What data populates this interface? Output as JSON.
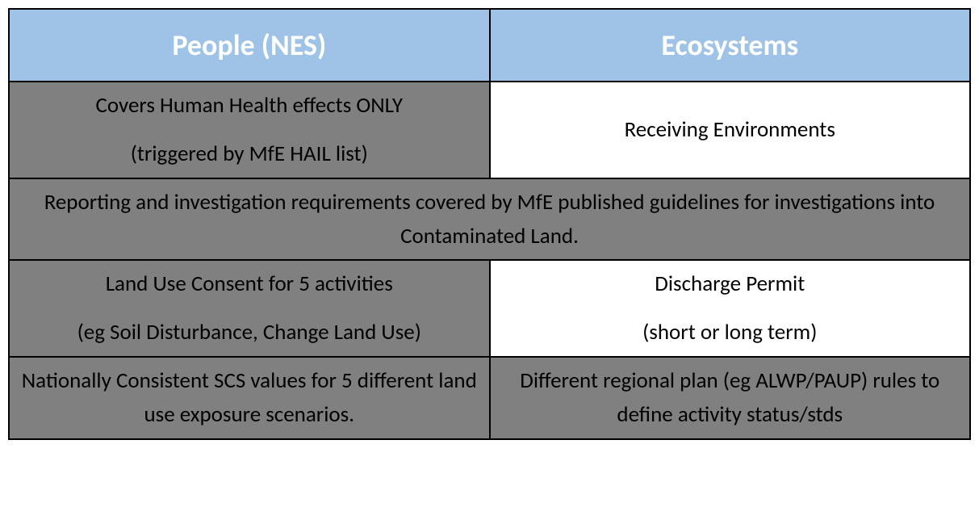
{
  "headers": {
    "col1": "People (NES)",
    "col2": "Ecosystems"
  },
  "row1": {
    "left_line1": "Covers Human Health effects ONLY",
    "left_line2": "(triggered by MfE HAIL list)",
    "right": "Receiving Environments"
  },
  "row2": {
    "merged": "Reporting and investigation requirements covered by MfE published guidelines for investigations into Contaminated Land."
  },
  "row3": {
    "left_line1": "Land Use Consent for 5 activities",
    "left_line2": "(eg Soil Disturbance, Change Land Use)",
    "right_line1": "Discharge Permit",
    "right_line2": "(short or long term)"
  },
  "row4": {
    "left": "Nationally Consistent SCS values for 5 different land use exposure scenarios.",
    "right": "Different regional plan (eg ALWP/PAUP) rules to define activity status/stds"
  }
}
